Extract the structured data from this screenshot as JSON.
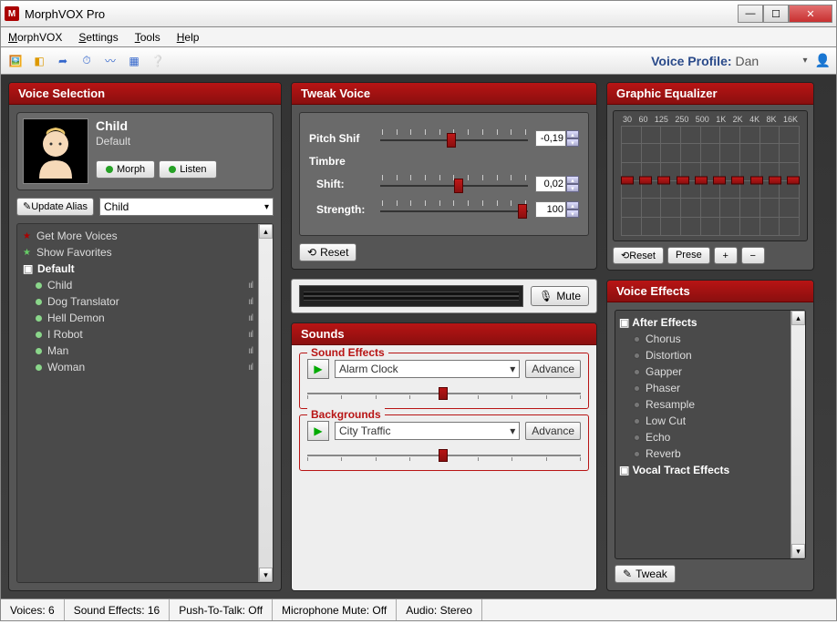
{
  "window": {
    "title": "MorphVOX Pro"
  },
  "menu": {
    "items": [
      "MorphVOX",
      "Settings",
      "Tools",
      "Help"
    ]
  },
  "toolbar": {
    "voice_profile_label": "Voice Profile:",
    "voice_profile_value": "Dan"
  },
  "voice_selection": {
    "title": "Voice Selection",
    "current_name": "Child",
    "current_sub": "Default",
    "morph_btn": "Morph",
    "listen_btn": "Listen",
    "update_alias_btn": "Update Alias",
    "alias_value": "Child",
    "get_more": "Get More Voices",
    "show_favs": "Show Favorites",
    "group": "Default",
    "items": [
      "Child",
      "Dog Translator",
      "Hell Demon",
      "I Robot",
      "Man",
      "Woman"
    ]
  },
  "tweak": {
    "title": "Tweak Voice",
    "pitch_label": "Pitch Shif",
    "pitch_value": "-0,19",
    "timbre_label": "Timbre",
    "shift_label": "Shift:",
    "shift_value": "0,02",
    "strength_label": "Strength:",
    "strength_value": "100",
    "reset_btn": "Reset"
  },
  "mute": {
    "btn": "Mute"
  },
  "sounds": {
    "title": "Sounds",
    "fx_label": "Sound Effects",
    "fx_value": "Alarm Clock",
    "bg_label": "Backgrounds",
    "bg_value": "City Traffic",
    "advance_btn": "Advance"
  },
  "eq": {
    "title": "Graphic Equalizer",
    "bands": [
      "30",
      "60",
      "125",
      "250",
      "500",
      "1K",
      "2K",
      "4K",
      "8K",
      "16K"
    ],
    "reset_btn": "Reset",
    "preset_btn": "Prese",
    "plus": "+",
    "minus": "−"
  },
  "effects": {
    "title": "Voice Effects",
    "group1": "After Effects",
    "group1_items": [
      "Chorus",
      "Distortion",
      "Gapper",
      "Phaser",
      "Resample",
      "Low Cut",
      "Echo",
      "Reverb"
    ],
    "group2": "Vocal Tract Effects",
    "tweak_btn": "Tweak"
  },
  "status": {
    "voices": "Voices: 6",
    "sfx": "Sound Effects: 16",
    "ptt": "Push-To-Talk: Off",
    "mic": "Microphone Mute: Off",
    "audio": "Audio: Stereo"
  }
}
